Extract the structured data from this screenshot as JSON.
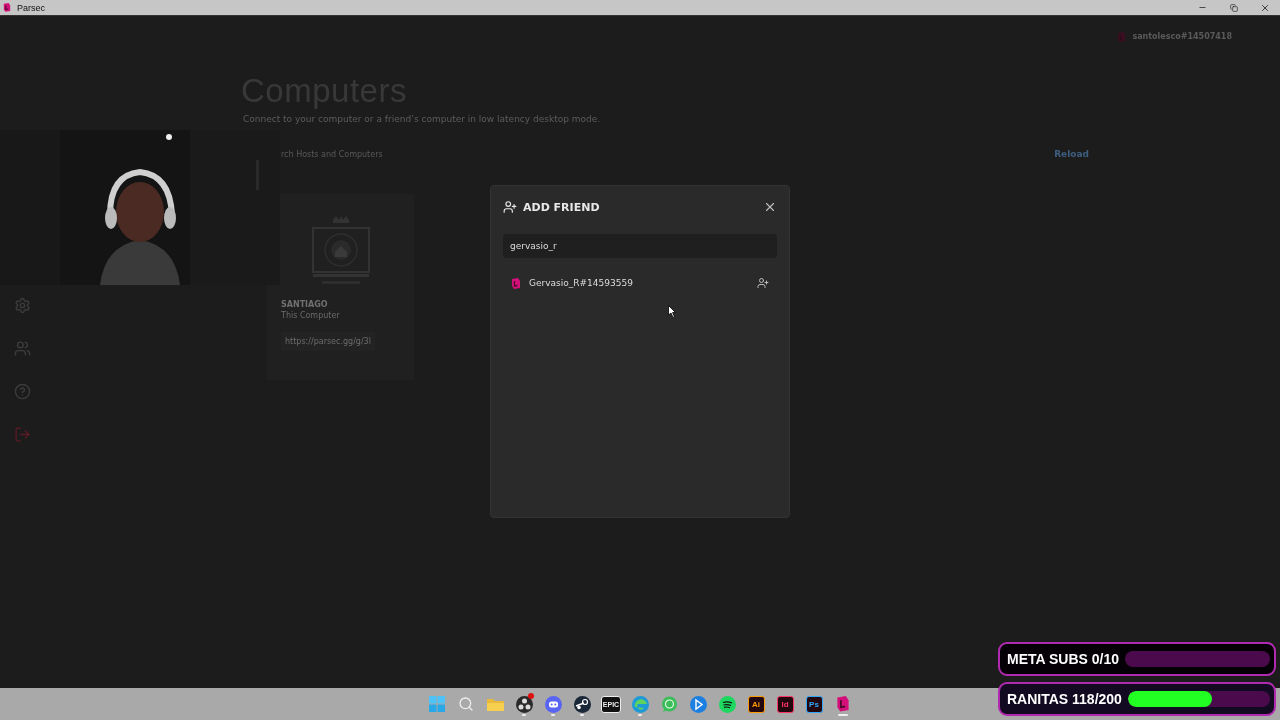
{
  "window": {
    "title": "Parsec"
  },
  "account": {
    "username": "santolesco#14507418"
  },
  "sidebar": {
    "items": [
      {
        "kind": "settings"
      },
      {
        "kind": "friends"
      },
      {
        "kind": "help"
      },
      {
        "kind": "logout"
      }
    ]
  },
  "page": {
    "title": "Computers",
    "subtitle": "Connect to your computer or a friend’s computer in low latency desktop mode.",
    "search": {
      "placeholder": "rch Hosts and Computers"
    },
    "reload": "Reload"
  },
  "computers": [
    {
      "name": "SANTIAGO",
      "description": "This Computer",
      "link": "https://parsec.gg/g/3l"
    }
  ],
  "dialog": {
    "title": "ADD FRIEND",
    "search": {
      "value": "gervasio_r"
    },
    "results": [
      {
        "name": "Gervasio_R#14593559"
      }
    ]
  },
  "goals": [
    {
      "label": "META SUBS 0/10"
    },
    {
      "label": "RANITAS 118/200",
      "level": 0.59
    }
  ],
  "taskbar": [
    {
      "kind": "start",
      "running": false
    },
    {
      "kind": "search",
      "running": false
    },
    {
      "kind": "folder",
      "running": false
    },
    {
      "kind": "obs",
      "running": true,
      "badge": true
    },
    {
      "kind": "discord",
      "running": true
    },
    {
      "kind": "steam",
      "running": true
    },
    {
      "kind": "epic",
      "label": "EPIC",
      "running": false
    },
    {
      "kind": "edge",
      "running": true
    },
    {
      "kind": "whatsapp",
      "running": false
    },
    {
      "kind": "blue",
      "running": false
    },
    {
      "kind": "spotify",
      "running": false
    },
    {
      "kind": "adobe",
      "label": "Ai",
      "color": "#ff9a00",
      "running": false
    },
    {
      "kind": "adobe",
      "label": "Id",
      "color": "#ff3366",
      "running": false
    },
    {
      "kind": "adobe",
      "label": "Ps",
      "color": "#31a8ff",
      "running": false
    },
    {
      "kind": "parsec",
      "running": true
    }
  ]
}
